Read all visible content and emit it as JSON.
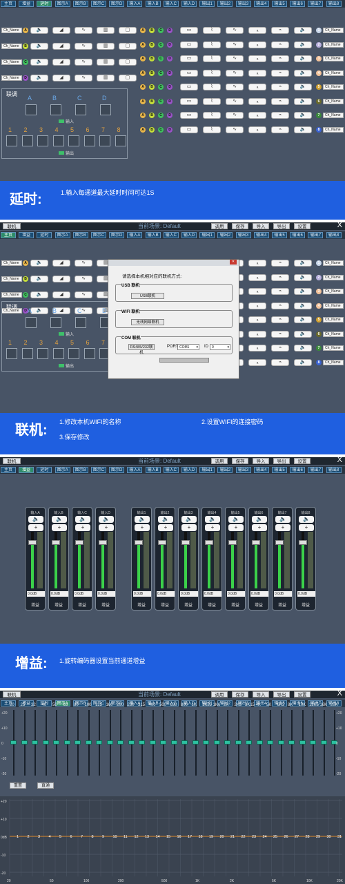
{
  "nav": [
    "主页",
    "增益",
    "延时",
    "图示A",
    "图示B",
    "图示C",
    "图示D",
    "输入A",
    "输入B",
    "输入C",
    "输入D",
    "输出1",
    "输出2",
    "输出3",
    "输出4",
    "输出5",
    "输出6",
    "输出7",
    "输出8"
  ],
  "titlebar": {
    "link": "联机",
    "scene": "当前场景: Default",
    "tune": "调用",
    "save": "保存",
    "import": "导入",
    "export": "导出",
    "settings": "设置",
    "close": "X"
  },
  "channels": {
    "in_name": "Ch_Name",
    "in_letters": [
      "A",
      "B",
      "C",
      "D"
    ],
    "out_letters": [
      "A",
      "B",
      "C",
      "D"
    ],
    "out_numbers": [
      "1",
      "2",
      "3",
      "4",
      "5",
      "6",
      "7",
      "8"
    ],
    "out_name": "Ch_Name"
  },
  "linkbox": {
    "title": "联调",
    "cols": [
      "A",
      "B",
      "C",
      "D"
    ],
    "nums": [
      "1",
      "2",
      "3",
      "4",
      "5",
      "6",
      "7",
      "8"
    ],
    "input_tag": "输入",
    "output_tag": "输出"
  },
  "delay": {
    "title": "延时:",
    "note": "1.输入每通道最大延时时间可达1S"
  },
  "online": {
    "title": "联机:",
    "note1": "1.修改本机WIFI的名称",
    "note2": "2.设置WIFI的连接密码",
    "note3": "3.保存修改"
  },
  "dialog": {
    "prompt": "请选择本机相对应的联机方式:",
    "usb_group": "USB 联机",
    "usb_btn": "USB联机",
    "wifi_group": "WIFI 联机",
    "wifi_btn": "无线网络联机",
    "com_group": "COM 联机",
    "com_btn": "RS485/232联机",
    "port_label": "PORT",
    "port_value": "COM1",
    "id_label": "ID",
    "id_value": "0"
  },
  "gain": {
    "title": "增益:",
    "note": "1.旋转编码器设置当前通道增益",
    "inputs": [
      "输入A",
      "输入B",
      "输入C",
      "输入D"
    ],
    "outputs": [
      "输出1",
      "输出2",
      "输出3",
      "输出4",
      "输出5",
      "输出6",
      "输出7",
      "输出8"
    ],
    "value": "0.0dB",
    "label": "增益",
    "levels": [
      0.78,
      0.78,
      0.78,
      0.78,
      0.78,
      0.78,
      0.78,
      0.78,
      0.78,
      0.78,
      0.78,
      0.78
    ],
    "plus": "+"
  },
  "eq": {
    "freqs": [
      "20",
      "25",
      "32",
      "40",
      "50",
      "63",
      "80",
      "100",
      "125",
      "160",
      "200",
      "250",
      "315",
      "400",
      "500",
      "630",
      "800",
      "1K",
      "1K25",
      "1K6",
      "2K",
      "2K5",
      "3K15",
      "4K",
      "5K",
      "6K3",
      "8K",
      "10K",
      "12K5",
      "16K",
      "20K"
    ],
    "db_scale": [
      "+20",
      "+10",
      "0",
      "-10",
      "-20"
    ],
    "reset": "重置",
    "bypass": "直通",
    "curve_scale": [
      "+20",
      "+10",
      "0dB",
      "-10",
      "-20"
    ],
    "bands": [
      "1",
      "2",
      "3",
      "4",
      "5",
      "6",
      "7",
      "8",
      "9",
      "10",
      "11",
      "12",
      "13",
      "14",
      "15",
      "16",
      "17",
      "18",
      "19",
      "20",
      "21",
      "22",
      "23",
      "24",
      "25",
      "26",
      "27",
      "28",
      "29",
      "30",
      "31"
    ],
    "x_axis": [
      "20",
      "50",
      "100",
      "200",
      "500",
      "1K",
      "2K",
      "5K",
      "10K",
      "20K"
    ]
  }
}
